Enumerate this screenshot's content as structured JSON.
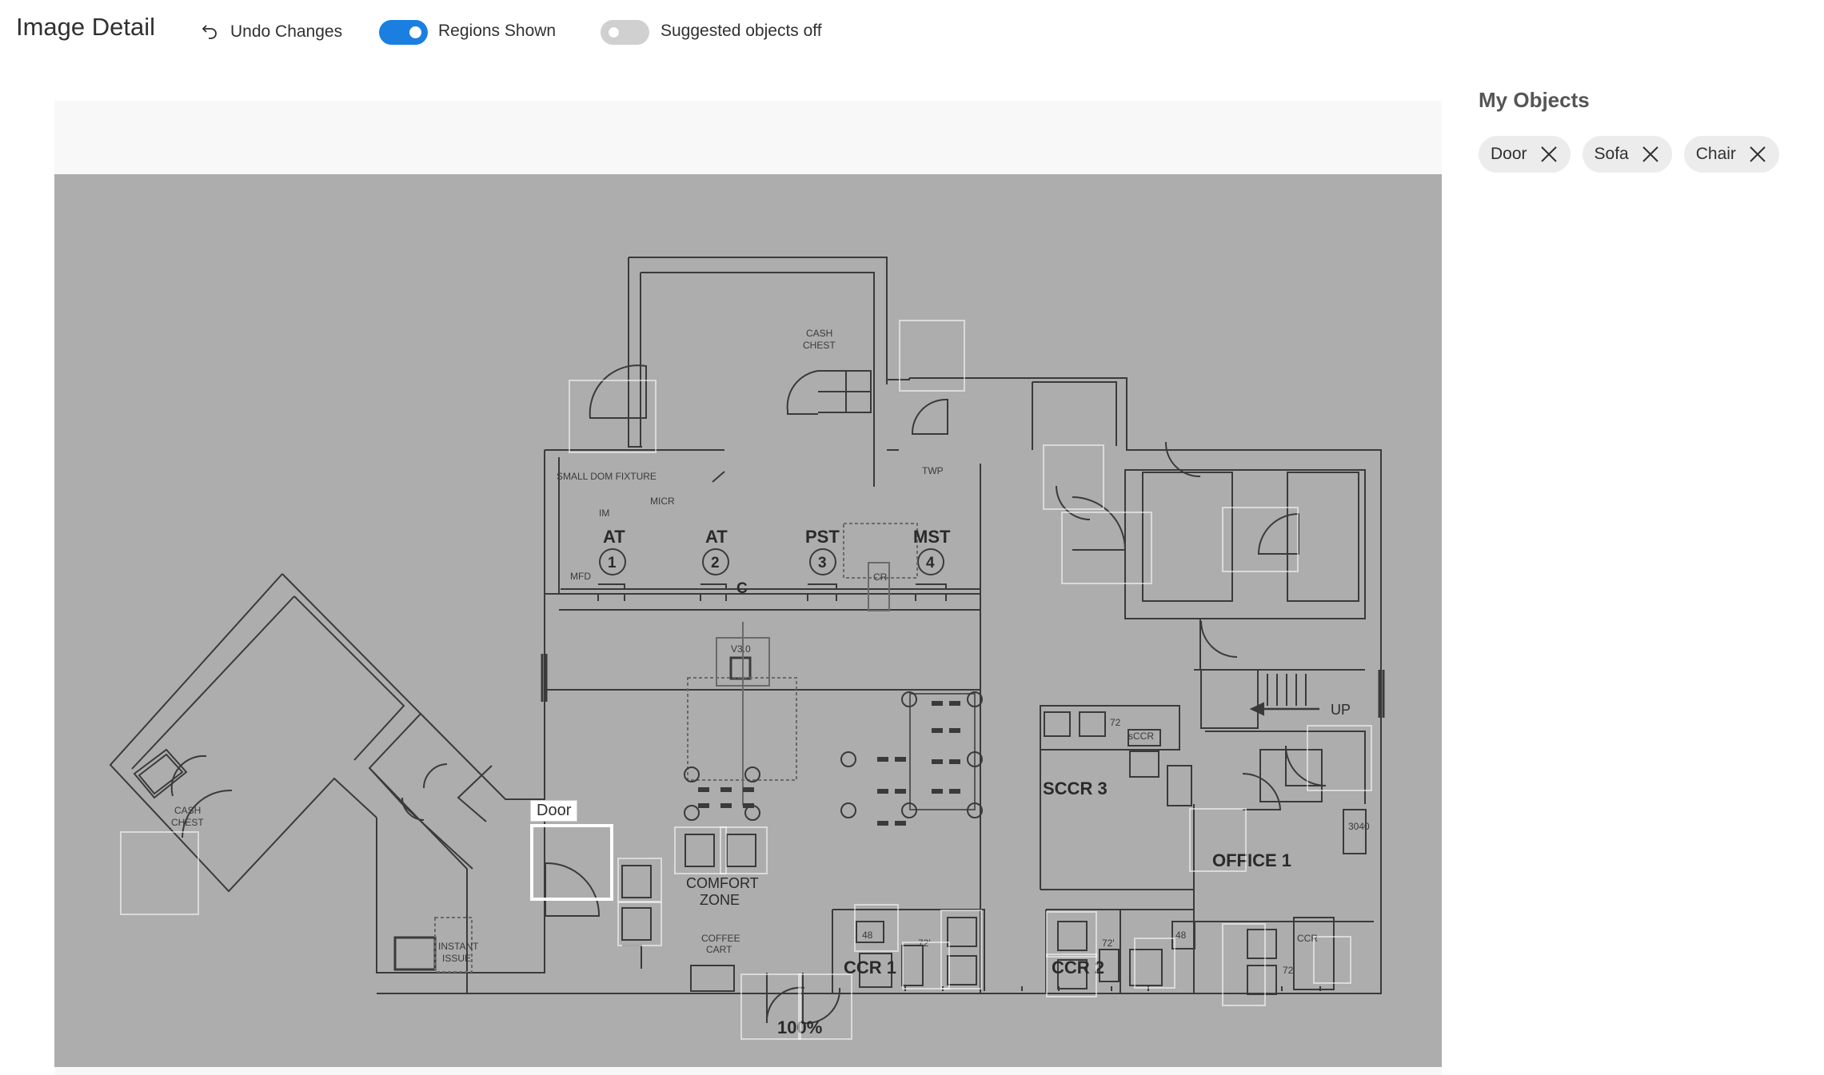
{
  "header": {
    "title": "Image Detail",
    "undo_label": "Undo Changes",
    "regions_toggle": {
      "label": "Regions Shown",
      "state": "on"
    },
    "suggested_toggle": {
      "label": "Suggested objects off",
      "state": "off"
    }
  },
  "sidebar": {
    "title": "My Objects",
    "objects": [
      {
        "label": "Door"
      },
      {
        "label": "Sofa"
      },
      {
        "label": "Chair"
      }
    ]
  },
  "canvas": {
    "active_region_label": "Door",
    "plan_labels": {
      "small_dom_fixture": "SMALL DOM FIXTURE",
      "micr": "MICR",
      "im": "IM",
      "mfd": "MFD",
      "cash_chest_top": [
        "CASH",
        "CHEST"
      ],
      "cash_chest_left": [
        "CASH",
        "CHEST"
      ],
      "twp": "TWP",
      "stations": [
        {
          "name": "AT",
          "num": "1"
        },
        {
          "name": "AT",
          "num": "2"
        },
        {
          "name": "PST",
          "num": "3"
        },
        {
          "name": "MST",
          "num": "4"
        }
      ],
      "cr": "CR",
      "v30": "V3.0",
      "c": "C",
      "up": "UP",
      "sccr_small": "sCCR",
      "n72": "72",
      "sccr3": "SCCR 3",
      "office1": "OFFICE 1",
      "comfort_zone": [
        "COMFORT",
        "ZONE"
      ],
      "coffee_cart": [
        "COFFEE",
        "CART"
      ],
      "instant_issue": [
        "INSTANT",
        "ISSUE"
      ],
      "ccr1": "CCR 1",
      "ccr2": "CCR 2",
      "n48a": "48",
      "n72a": "72'",
      "n48b": "48",
      "n72b": "72'",
      "n3040": "3040",
      "ccr_small": "CCR",
      "n72c": "72",
      "pct": "100%"
    }
  },
  "colors": {
    "accent": "#1a7fe0",
    "image_bg": "#adadad",
    "plan_line": "#3a3a3a",
    "region_border": "#ffffff"
  }
}
